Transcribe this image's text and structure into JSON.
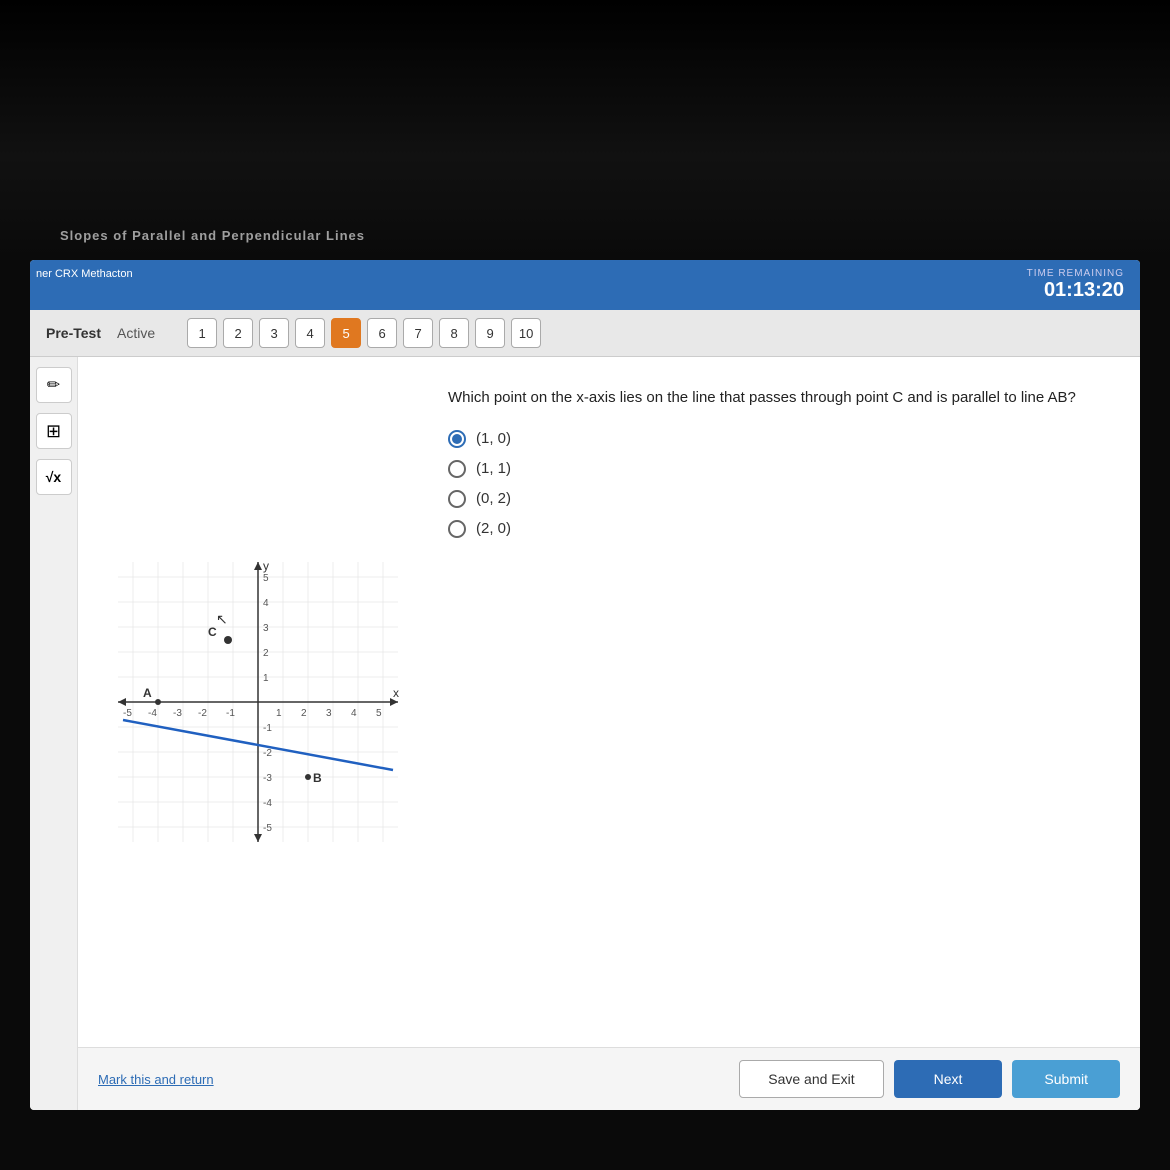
{
  "header": {
    "crx_label": "ner CRX Methacton",
    "partial_title": "Slopes of Parallel and Perpendicular Lines",
    "time_label": "TIME REMAINING",
    "time_value": "01:13:20"
  },
  "sub_bar": {
    "pre_test_label": "Pre-Test",
    "active_label": "Active",
    "question_numbers": [
      1,
      2,
      3,
      4,
      5,
      6,
      7,
      8,
      9,
      10
    ],
    "active_question": 5
  },
  "tools": [
    {
      "icon": "✏",
      "name": "pencil"
    },
    {
      "icon": "⊞",
      "name": "calculator"
    },
    {
      "icon": "√",
      "name": "formula"
    }
  ],
  "question": {
    "text": "Which point on the x-axis lies on the line that passes through point C and is parallel to line AB?",
    "options": [
      {
        "label": "(1, 0)",
        "selected": true
      },
      {
        "label": "(1, 1)",
        "selected": false
      },
      {
        "label": "(0, 2)",
        "selected": false
      },
      {
        "label": "(2, 0)",
        "selected": false
      }
    ]
  },
  "bottom_bar": {
    "mark_return": "Mark this and return",
    "save_exit_label": "Save and Exit",
    "next_label": "Next",
    "submit_label": "Submit"
  }
}
